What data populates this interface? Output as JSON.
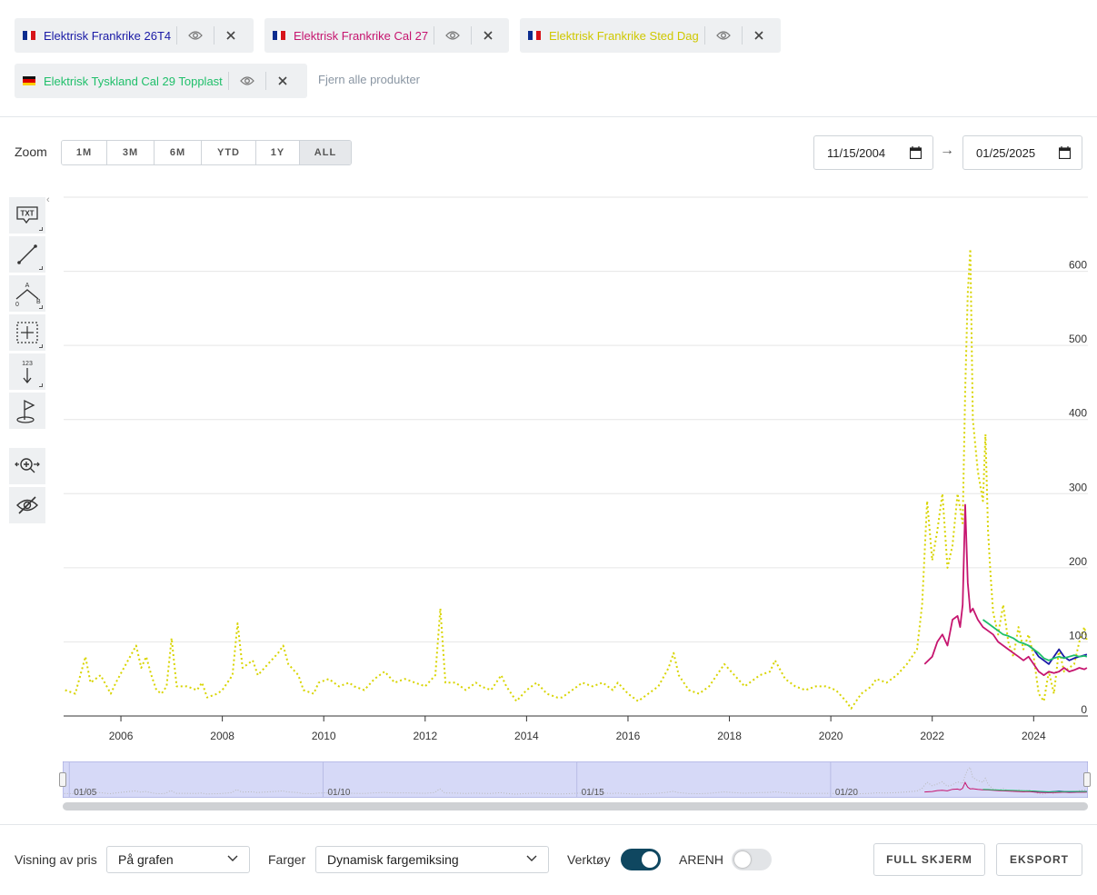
{
  "products": [
    {
      "name": "Elektrisk Frankrike 26T4",
      "flag": "fr",
      "color": "#1a1aa6"
    },
    {
      "name": "Elektrisk Frankrike Cal 27",
      "flag": "fr",
      "color": "#c6156f"
    },
    {
      "name": "Elektrisk Frankrike Sted Dag",
      "flag": "fr",
      "color": "#d8d400"
    },
    {
      "name": "Elektrisk Tyskland Cal 29 Topplast",
      "flag": "de",
      "color": "#1fbf6a"
    }
  ],
  "clear_all": "Fjern alle produkter",
  "zoom": {
    "label": "Zoom",
    "buttons": [
      "1M",
      "3M",
      "6M",
      "YTD",
      "1Y",
      "ALL"
    ],
    "active": "ALL"
  },
  "date_range": {
    "from": "11/15/2004",
    "arrow": "→",
    "to": "01/25/2025"
  },
  "tools": {
    "text": "TXT",
    "fib_a": "A",
    "fib_0": "0",
    "fib_b": "B",
    "measure": "123"
  },
  "navigator": {
    "labels": [
      "01/05",
      "01/10",
      "01/15",
      "01/20"
    ]
  },
  "bottom": {
    "price_label": "Visning av pris",
    "price_value": "På grafen",
    "colors_label": "Farger",
    "colors_value": "Dynamisk fargemiksing",
    "tools_label": "Verktøy",
    "tools_on": true,
    "arenh_label": "ARENH",
    "arenh_on": false,
    "fullscreen": "FULL SKJERM",
    "export": "EKSPORT"
  },
  "chart_data": {
    "type": "line",
    "x_ticks": [
      "2006",
      "2008",
      "2010",
      "2012",
      "2014",
      "2016",
      "2018",
      "2020",
      "2022",
      "2024"
    ],
    "y_ticks": [
      0,
      100,
      200,
      300,
      400,
      500,
      600
    ],
    "xlim": [
      2004.87,
      2025.07
    ],
    "ylim": [
      0,
      700
    ],
    "grid": true,
    "series": [
      {
        "name": "Elektrisk Frankrike Sted Dag",
        "color": "#d8d400",
        "dash": "2,3",
        "points": [
          [
            2004.9,
            35
          ],
          [
            2005.1,
            30
          ],
          [
            2005.3,
            80
          ],
          [
            2005.4,
            45
          ],
          [
            2005.6,
            55
          ],
          [
            2005.8,
            30
          ],
          [
            2005.9,
            45
          ],
          [
            2006.1,
            70
          ],
          [
            2006.3,
            95
          ],
          [
            2006.4,
            65
          ],
          [
            2006.5,
            80
          ],
          [
            2006.6,
            55
          ],
          [
            2006.7,
            35
          ],
          [
            2006.8,
            30
          ],
          [
            2006.9,
            40
          ],
          [
            2007.0,
            105
          ],
          [
            2007.1,
            40
          ],
          [
            2007.3,
            40
          ],
          [
            2007.5,
            35
          ],
          [
            2007.6,
            45
          ],
          [
            2007.7,
            25
          ],
          [
            2007.9,
            30
          ],
          [
            2008.0,
            35
          ],
          [
            2008.2,
            55
          ],
          [
            2008.3,
            125
          ],
          [
            2008.4,
            65
          ],
          [
            2008.6,
            75
          ],
          [
            2008.7,
            55
          ],
          [
            2008.9,
            70
          ],
          [
            2009.1,
            85
          ],
          [
            2009.2,
            95
          ],
          [
            2009.3,
            70
          ],
          [
            2009.5,
            55
          ],
          [
            2009.6,
            35
          ],
          [
            2009.8,
            30
          ],
          [
            2009.9,
            45
          ],
          [
            2010.1,
            50
          ],
          [
            2010.3,
            40
          ],
          [
            2010.5,
            45
          ],
          [
            2010.6,
            40
          ],
          [
            2010.8,
            35
          ],
          [
            2011.0,
            50
          ],
          [
            2011.2,
            60
          ],
          [
            2011.4,
            45
          ],
          [
            2011.6,
            50
          ],
          [
            2011.8,
            45
          ],
          [
            2012.0,
            40
          ],
          [
            2012.2,
            55
          ],
          [
            2012.3,
            145
          ],
          [
            2012.4,
            45
          ],
          [
            2012.6,
            45
          ],
          [
            2012.8,
            35
          ],
          [
            2013.0,
            45
          ],
          [
            2013.1,
            40
          ],
          [
            2013.3,
            35
          ],
          [
            2013.5,
            55
          ],
          [
            2013.6,
            40
          ],
          [
            2013.8,
            20
          ],
          [
            2014.0,
            35
          ],
          [
            2014.2,
            45
          ],
          [
            2014.4,
            30
          ],
          [
            2014.6,
            25
          ],
          [
            2014.7,
            25
          ],
          [
            2014.9,
            35
          ],
          [
            2015.1,
            45
          ],
          [
            2015.3,
            40
          ],
          [
            2015.5,
            45
          ],
          [
            2015.7,
            35
          ],
          [
            2015.8,
            45
          ],
          [
            2016.0,
            30
          ],
          [
            2016.2,
            20
          ],
          [
            2016.4,
            30
          ],
          [
            2016.6,
            40
          ],
          [
            2016.8,
            65
          ],
          [
            2016.9,
            85
          ],
          [
            2017.0,
            55
          ],
          [
            2017.2,
            35
          ],
          [
            2017.4,
            30
          ],
          [
            2017.6,
            40
          ],
          [
            2017.8,
            60
          ],
          [
            2017.9,
            70
          ],
          [
            2018.1,
            55
          ],
          [
            2018.3,
            40
          ],
          [
            2018.4,
            45
          ],
          [
            2018.6,
            55
          ],
          [
            2018.8,
            60
          ],
          [
            2018.9,
            75
          ],
          [
            2019.1,
            50
          ],
          [
            2019.3,
            40
          ],
          [
            2019.5,
            35
          ],
          [
            2019.7,
            40
          ],
          [
            2019.9,
            40
          ],
          [
            2020.1,
            35
          ],
          [
            2020.3,
            20
          ],
          [
            2020.4,
            10
          ],
          [
            2020.6,
            30
          ],
          [
            2020.8,
            40
          ],
          [
            2020.9,
            50
          ],
          [
            2021.1,
            45
          ],
          [
            2021.3,
            55
          ],
          [
            2021.5,
            70
          ],
          [
            2021.7,
            90
          ],
          [
            2021.8,
            150
          ],
          [
            2021.9,
            290
          ],
          [
            2022.0,
            210
          ],
          [
            2022.1,
            250
          ],
          [
            2022.2,
            300
          ],
          [
            2022.3,
            200
          ],
          [
            2022.4,
            230
          ],
          [
            2022.5,
            300
          ],
          [
            2022.6,
            260
          ],
          [
            2022.65,
            440
          ],
          [
            2022.7,
            570
          ],
          [
            2022.75,
            630
          ],
          [
            2022.8,
            400
          ],
          [
            2022.9,
            330
          ],
          [
            2023.0,
            290
          ],
          [
            2023.05,
            380
          ],
          [
            2023.1,
            250
          ],
          [
            2023.15,
            190
          ],
          [
            2023.2,
            140
          ],
          [
            2023.3,
            110
          ],
          [
            2023.4,
            150
          ],
          [
            2023.5,
            100
          ],
          [
            2023.6,
            80
          ],
          [
            2023.7,
            120
          ],
          [
            2023.8,
            90
          ],
          [
            2023.9,
            110
          ],
          [
            2024.0,
            80
          ],
          [
            2024.1,
            30
          ],
          [
            2024.2,
            20
          ],
          [
            2024.3,
            60
          ],
          [
            2024.4,
            30
          ],
          [
            2024.5,
            90
          ],
          [
            2024.6,
            60
          ],
          [
            2024.8,
            70
          ],
          [
            2024.9,
            100
          ],
          [
            2025.0,
            120
          ],
          [
            2025.05,
            100
          ]
        ]
      },
      {
        "name": "Elektrisk Frankrike Cal 27",
        "color": "#c6156f",
        "dash": "",
        "points": [
          [
            2021.85,
            70
          ],
          [
            2022.0,
            80
          ],
          [
            2022.1,
            100
          ],
          [
            2022.2,
            110
          ],
          [
            2022.3,
            95
          ],
          [
            2022.4,
            130
          ],
          [
            2022.5,
            135
          ],
          [
            2022.55,
            120
          ],
          [
            2022.6,
            150
          ],
          [
            2022.65,
            285
          ],
          [
            2022.7,
            180
          ],
          [
            2022.75,
            140
          ],
          [
            2022.8,
            145
          ],
          [
            2022.9,
            130
          ],
          [
            2023.0,
            120
          ],
          [
            2023.1,
            115
          ],
          [
            2023.2,
            110
          ],
          [
            2023.3,
            100
          ],
          [
            2023.4,
            95
          ],
          [
            2023.5,
            90
          ],
          [
            2023.6,
            85
          ],
          [
            2023.7,
            80
          ],
          [
            2023.8,
            75
          ],
          [
            2023.9,
            80
          ],
          [
            2024.0,
            70
          ],
          [
            2024.1,
            60
          ],
          [
            2024.2,
            55
          ],
          [
            2024.3,
            60
          ],
          [
            2024.4,
            58
          ],
          [
            2024.5,
            60
          ],
          [
            2024.6,
            65
          ],
          [
            2024.7,
            60
          ],
          [
            2024.8,
            62
          ],
          [
            2024.9,
            65
          ],
          [
            2025.0,
            63
          ],
          [
            2025.05,
            65
          ]
        ]
      },
      {
        "name": "Elektrisk Frankrike 26T4",
        "color": "#1a1aa6",
        "dash": "",
        "points": [
          [
            2023.9,
            95
          ],
          [
            2024.0,
            90
          ],
          [
            2024.1,
            80
          ],
          [
            2024.2,
            75
          ],
          [
            2024.3,
            70
          ],
          [
            2024.4,
            80
          ],
          [
            2024.5,
            90
          ],
          [
            2024.6,
            80
          ],
          [
            2024.7,
            75
          ],
          [
            2024.8,
            78
          ],
          [
            2024.9,
            80
          ],
          [
            2025.0,
            82
          ],
          [
            2025.05,
            83
          ]
        ]
      },
      {
        "name": "Elektrisk Tyskland Cal 29 Topplast",
        "color": "#1fbf6a",
        "dash": "",
        "points": [
          [
            2023.0,
            130
          ],
          [
            2023.1,
            125
          ],
          [
            2023.2,
            120
          ],
          [
            2023.3,
            115
          ],
          [
            2023.4,
            110
          ],
          [
            2023.5,
            108
          ],
          [
            2023.6,
            105
          ],
          [
            2023.7,
            100
          ],
          [
            2023.8,
            98
          ],
          [
            2023.9,
            95
          ],
          [
            2024.0,
            90
          ],
          [
            2024.1,
            85
          ],
          [
            2024.2,
            78
          ],
          [
            2024.3,
            75
          ],
          [
            2024.4,
            78
          ],
          [
            2024.5,
            80
          ],
          [
            2024.6,
            78
          ],
          [
            2024.7,
            80
          ],
          [
            2024.8,
            82
          ],
          [
            2024.9,
            80
          ],
          [
            2025.0,
            81
          ],
          [
            2025.05,
            80
          ]
        ]
      }
    ]
  }
}
